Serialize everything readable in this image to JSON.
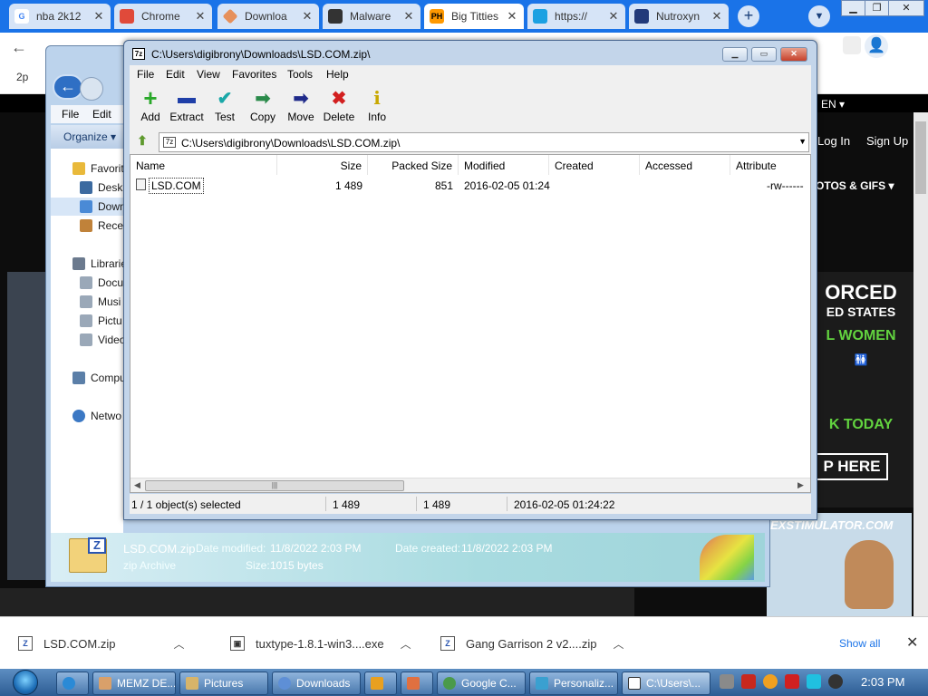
{
  "browser": {
    "tabs": [
      {
        "title": "nba 2k12",
        "favicon": "G",
        "color": "#ffffff"
      },
      {
        "title": "Chrome",
        "favicon": "",
        "color": "#e04a3a"
      },
      {
        "title": "Downloa",
        "favicon": "",
        "color": "#e6905b"
      },
      {
        "title": "Malware",
        "favicon": "",
        "color": "#333333"
      },
      {
        "title": "Big Titties",
        "favicon": "PH",
        "color": "#ff9900"
      },
      {
        "title": "https://",
        "favicon": "",
        "color": "#1ba1e2"
      },
      {
        "title": "Nutroxyn",
        "favicon": "",
        "color": "#223a7a"
      }
    ],
    "new_tab": "+",
    "bookmark": "2p"
  },
  "website": {
    "language": "EN ▾",
    "login": "Log In",
    "signup": "Sign Up",
    "nav_item": "OTOS & GIFS ▾",
    "ad_lines": [
      "ORCED",
      "ED STATES",
      "L WOMEN",
      "K TODAY",
      "P HERE"
    ],
    "ad2": "EXSTIMULATOR.COM"
  },
  "explorer": {
    "menu": [
      "File",
      "Edit"
    ],
    "organize": "Organize ▾",
    "sidebar": [
      {
        "label": "Favorit",
        "color": "#e9b93a"
      },
      {
        "label": "Desk",
        "color": "#3c6aa0"
      },
      {
        "label": "Down",
        "color": "#4a8ad6",
        "selected": true
      },
      {
        "label": "Rece",
        "color": "#c0823a"
      },
      {
        "label": "Librarie",
        "color": "#6b7a8e"
      },
      {
        "label": "Docu",
        "color": "#9aa8b8"
      },
      {
        "label": "Musi",
        "color": "#9aa8b8"
      },
      {
        "label": "Pictu",
        "color": "#9aa8b8"
      },
      {
        "label": "Video",
        "color": "#9aa8b8"
      },
      {
        "label": "Compu",
        "color": "#5b7fa8"
      },
      {
        "label": "Netwo",
        "color": "#3b78c4"
      }
    ],
    "details": {
      "name": "LSD.COM.zip",
      "type": "zip Archive",
      "modified_label": "Date modified:",
      "modified": "11/8/2022 2:03 PM",
      "created_label": "Date created:",
      "created": "11/8/2022 2:03 PM",
      "size_label": "Size:",
      "size": "1015 bytes"
    }
  },
  "sevenzip": {
    "logo": "7z",
    "title": "C:\\Users\\digibrony\\Downloads\\LSD.COM.zip\\",
    "menu": [
      "File",
      "Edit",
      "View",
      "Favorites",
      "Tools",
      "Help"
    ],
    "toolbar": [
      {
        "label": "Add",
        "icon": "+",
        "color": "#2aa82a"
      },
      {
        "label": "Extract",
        "icon": "▬",
        "color": "#1f3fa8"
      },
      {
        "label": "Test",
        "icon": "✔",
        "color": "#1aa8a8"
      },
      {
        "label": "Copy",
        "icon": "➡",
        "color": "#2a8a4a"
      },
      {
        "label": "Move",
        "icon": "➡",
        "color": "#1f2a8a"
      },
      {
        "label": "Delete",
        "icon": "✖",
        "color": "#d21f1f"
      },
      {
        "label": "Info",
        "icon": "i",
        "color": "#c8a800"
      }
    ],
    "address": "C:\\Users\\digibrony\\Downloads\\LSD.COM.zip\\",
    "columns": [
      "Name",
      "Size",
      "Packed Size",
      "Modified",
      "Created",
      "Accessed",
      "Attribute"
    ],
    "rows": [
      {
        "name": "LSD.COM",
        "size": "1 489",
        "packed": "851",
        "modified": "2016-02-05 01:24",
        "created": "",
        "accessed": "",
        "attributes": "-rw------"
      }
    ],
    "scroll_grip": "|||",
    "status": {
      "selection": "1 / 1 object(s) selected",
      "size": "1 489",
      "packed": "1 489",
      "modified": "2016-02-05 01:24:22"
    }
  },
  "downloads": {
    "items": [
      {
        "name": "LSD.COM.zip",
        "icon": "Z"
      },
      {
        "name": "tuxtype-1.8.1-win3....exe",
        "icon": "▣"
      },
      {
        "name": "Gang Garrison 2 v2....zip",
        "icon": "Z"
      }
    ],
    "show_all": "Show all",
    "close": "✕"
  },
  "taskbar": {
    "buttons": [
      {
        "label": "MEMZ DE...",
        "color": "#d9a06a"
      },
      {
        "label": "Pictures",
        "color": "#d7b46a"
      },
      {
        "label": "Downloads",
        "color": "#5e8fd6"
      },
      {
        "label": "",
        "color": "#e8a020"
      },
      {
        "label": "",
        "color": "#e07040"
      },
      {
        "label": "Google C...",
        "color": "#4a9a4a"
      },
      {
        "label": "Personaliz...",
        "color": "#3aa0d0"
      },
      {
        "label": "C:\\Users\\...",
        "color": "#ffffff"
      }
    ],
    "clock": "2:03 PM"
  }
}
